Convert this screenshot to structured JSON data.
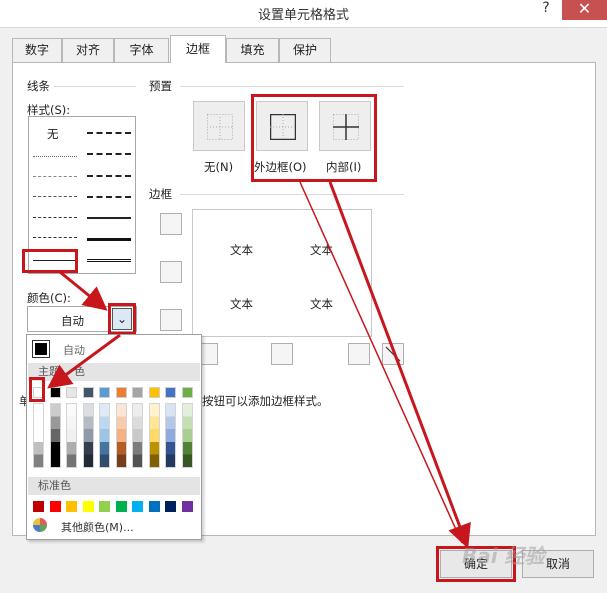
{
  "window": {
    "title": "设置单元格格式",
    "help_label": "?",
    "close_label": "✕"
  },
  "tabs": [
    {
      "label": "数字"
    },
    {
      "label": "对齐"
    },
    {
      "label": "字体"
    },
    {
      "label": "边框"
    },
    {
      "label": "填充"
    },
    {
      "label": "保护"
    }
  ],
  "active_tab": "边框",
  "line_section": {
    "title": "线条",
    "style_label": "样式(S):",
    "none_label": "无",
    "color_label": "颜色(C):",
    "color_value": "自动"
  },
  "preset_section": {
    "title": "预置",
    "none_label": "无(N)",
    "outline_label": "外边框(O)",
    "inside_label": "内部(I)"
  },
  "border_section": {
    "title": "边框",
    "preview_texts": [
      "文本",
      "文本",
      "文本",
      "文本"
    ]
  },
  "hint_text": {
    "left": "单",
    "right": "按钮可以添加边框样式。"
  },
  "color_popup": {
    "auto_label": "自动",
    "theme_header": "主题颜色",
    "theme_header_visible": "主题",
    "theme_header_tail": "色",
    "standard_header": "标准色",
    "more_label": "其他颜色(M)..."
  },
  "colors": {
    "theme_top": [
      "#ffffff",
      "#000000",
      "#e7e6e6",
      "#44546a",
      "#5b9bd5",
      "#ed7d31",
      "#a5a5a5",
      "#ffc000",
      "#4472c4",
      "#70ad47"
    ],
    "standard": [
      "#c00000",
      "#ff0000",
      "#ffc000",
      "#ffff00",
      "#92d050",
      "#00b050",
      "#00b0f0",
      "#0070c0",
      "#002060",
      "#7030a0"
    ],
    "highlight": "#c8161d"
  },
  "footer": {
    "ok_label": "确定",
    "cancel_label": "取消"
  },
  "watermark": "Bai 经验"
}
